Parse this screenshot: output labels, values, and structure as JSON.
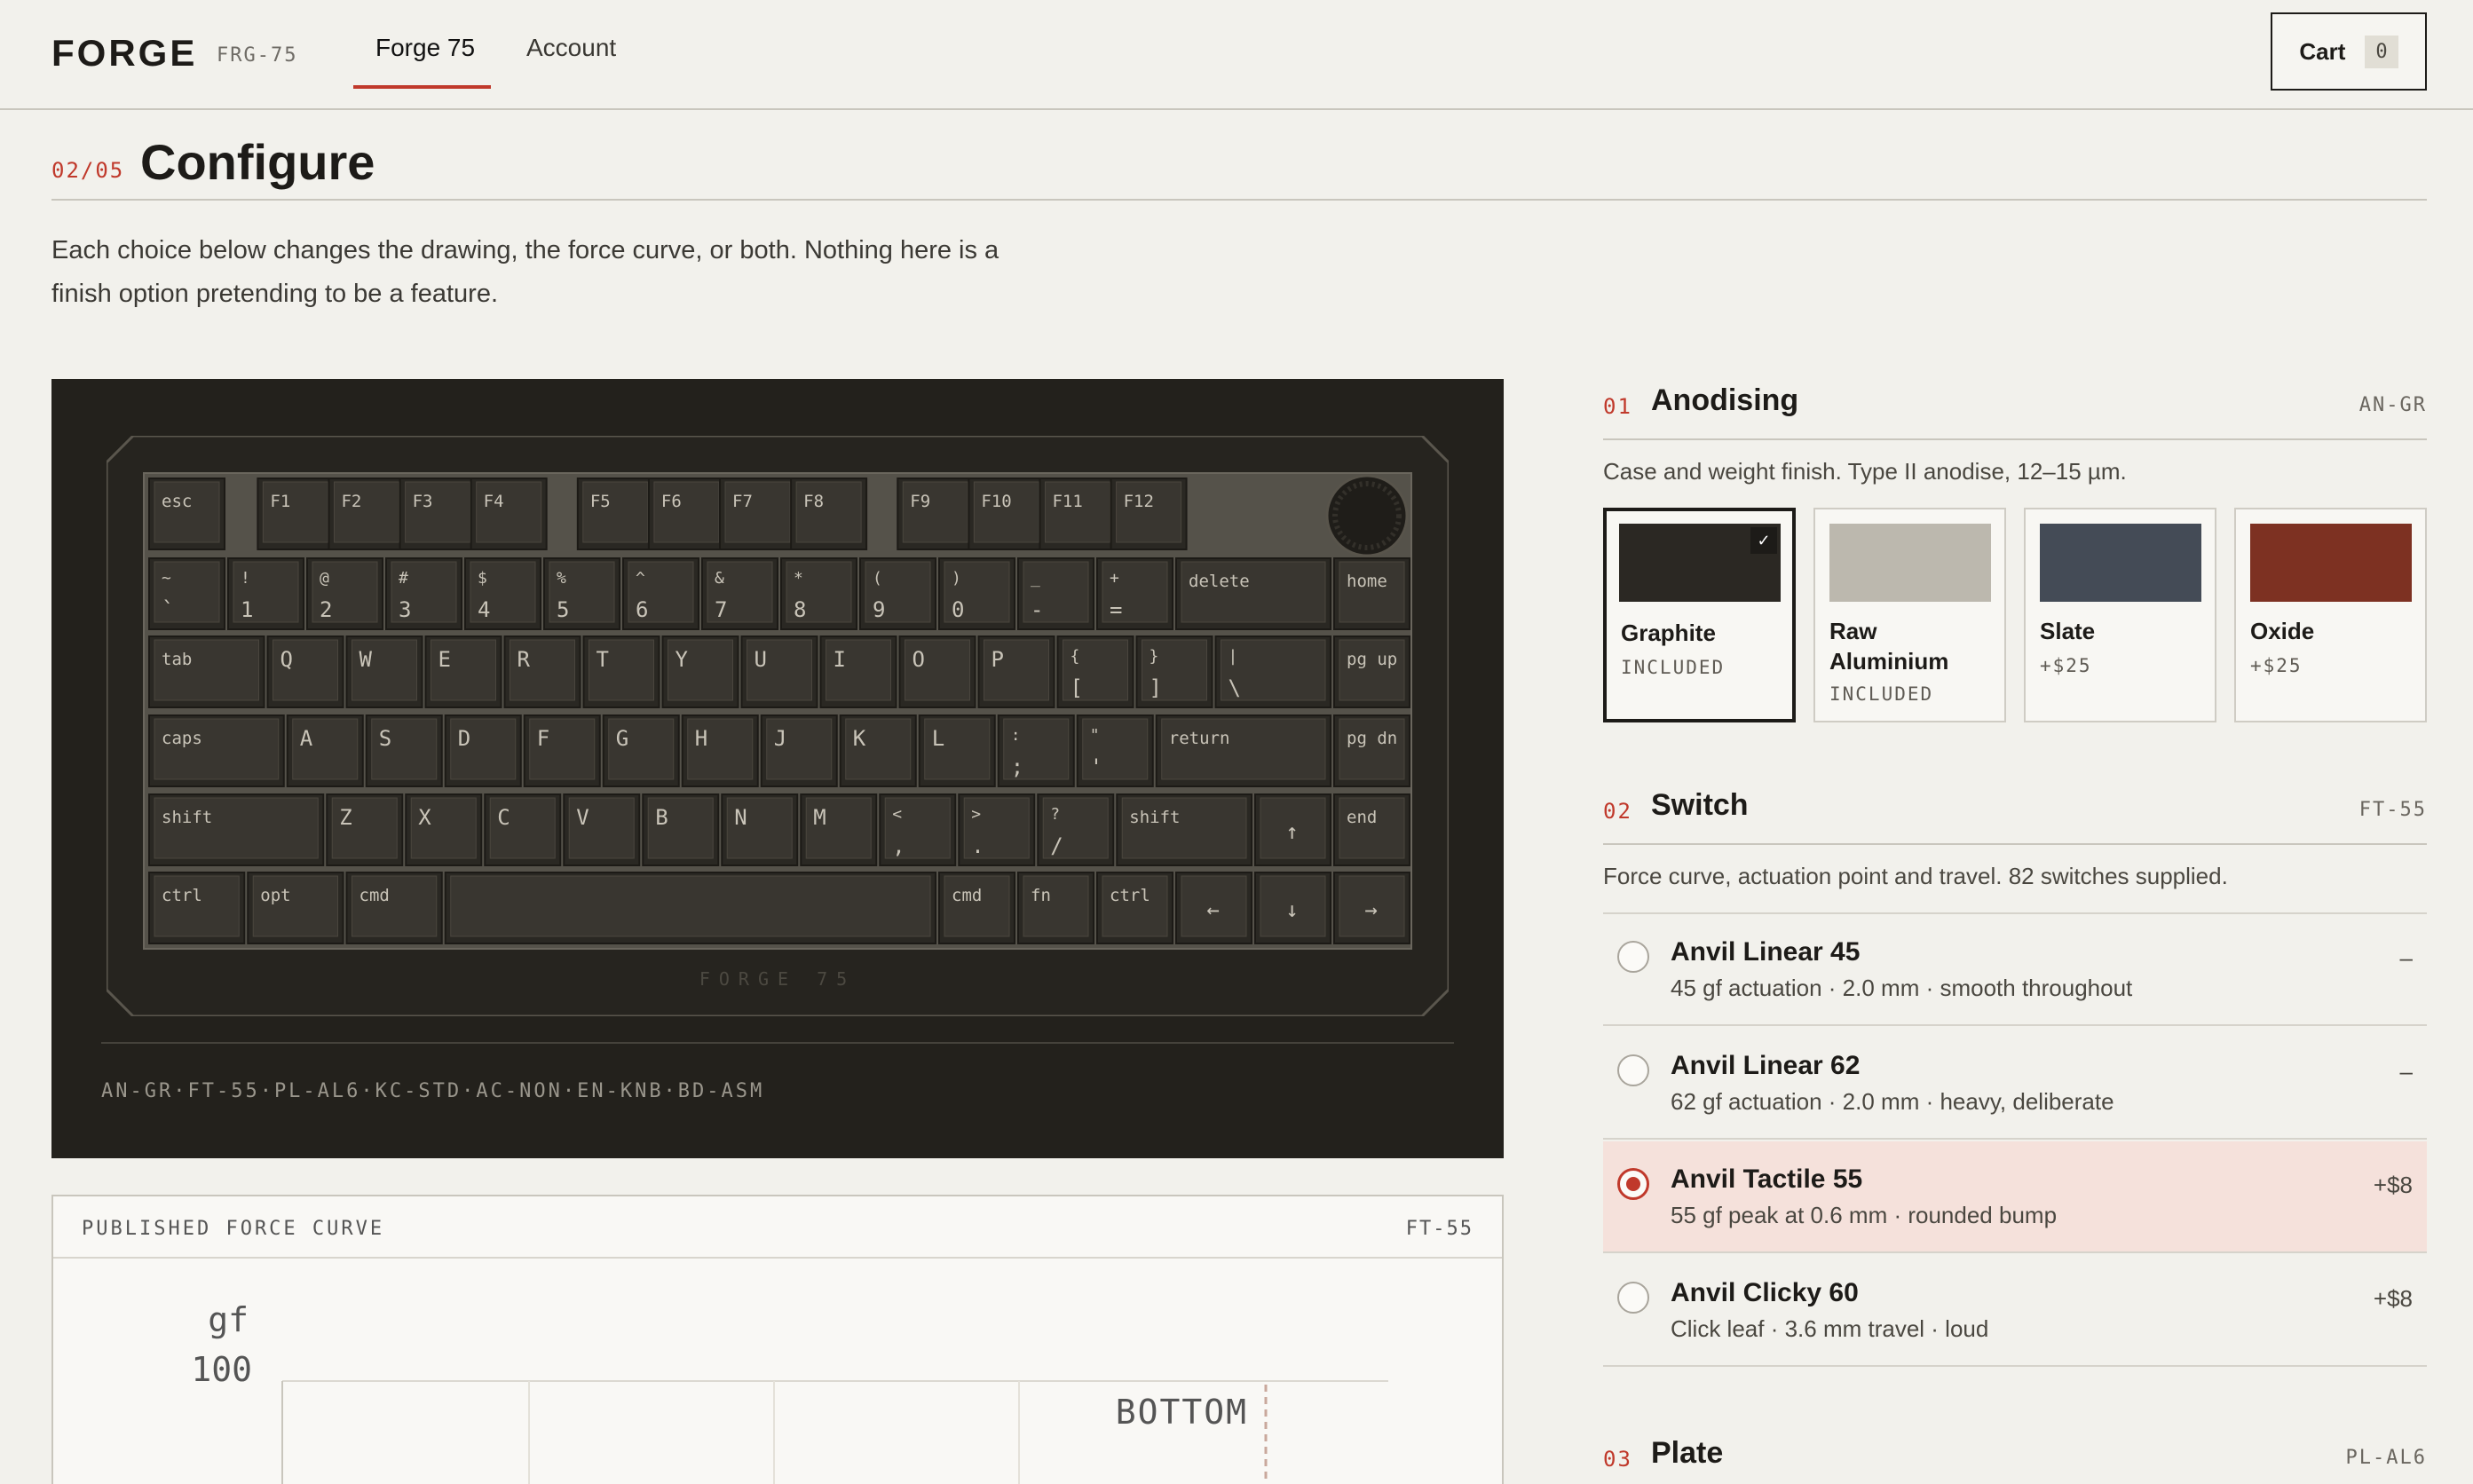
{
  "header": {
    "logo": "FORGE",
    "model_code": "FRG-75",
    "nav": [
      {
        "label": "Forge 75",
        "active": true
      },
      {
        "label": "Account",
        "active": false
      }
    ],
    "cart": {
      "label": "Cart",
      "count": "0"
    }
  },
  "page": {
    "step": "02/05",
    "title": "Configure",
    "intro": "Each choice below changes the drawing, the force curve, or both. Nothing here is a finish option pretending to be a feature."
  },
  "viewer": {
    "brand_plate": "FORGE 75",
    "config_code": "AN-GR·FT-55·PL-AL6·KC-STD·AC-NON·EN-KNB·BD-ASM",
    "keyboard_rows": [
      [
        {
          "l": "esc"
        },
        {
          "l": "F1"
        },
        {
          "l": "F2"
        },
        {
          "l": "F3"
        },
        {
          "l": "F4"
        },
        {
          "l": "F5"
        },
        {
          "l": "F6"
        },
        {
          "l": "F7"
        },
        {
          "l": "F8"
        },
        {
          "l": "F9"
        },
        {
          "l": "F10"
        },
        {
          "l": "F11"
        },
        {
          "l": "F12"
        }
      ],
      [
        {
          "t": "~",
          "b": "`"
        },
        {
          "t": "!",
          "b": "1"
        },
        {
          "t": "@",
          "b": "2"
        },
        {
          "t": "#",
          "b": "3"
        },
        {
          "t": "$",
          "b": "4"
        },
        {
          "t": "%",
          "b": "5"
        },
        {
          "t": "^",
          "b": "6"
        },
        {
          "t": "&",
          "b": "7"
        },
        {
          "t": "*",
          "b": "8"
        },
        {
          "t": "(",
          "b": "9"
        },
        {
          "t": ")",
          "b": "0"
        },
        {
          "t": "_",
          "b": "-"
        },
        {
          "t": "+",
          "b": "="
        },
        {
          "l": "delete"
        },
        {
          "l": "home"
        }
      ],
      [
        {
          "l": "tab"
        },
        {
          "c": "Q"
        },
        {
          "c": "W"
        },
        {
          "c": "E"
        },
        {
          "c": "R"
        },
        {
          "c": "T"
        },
        {
          "c": "Y"
        },
        {
          "c": "U"
        },
        {
          "c": "I"
        },
        {
          "c": "O"
        },
        {
          "c": "P"
        },
        {
          "t": "{",
          "b": "["
        },
        {
          "t": "}",
          "b": "]"
        },
        {
          "t": "|",
          "b": "\\"
        },
        {
          "l": "pg up"
        }
      ],
      [
        {
          "l": "caps"
        },
        {
          "c": "A"
        },
        {
          "c": "S"
        },
        {
          "c": "D"
        },
        {
          "c": "F"
        },
        {
          "c": "G"
        },
        {
          "c": "H"
        },
        {
          "c": "J"
        },
        {
          "c": "K"
        },
        {
          "c": "L"
        },
        {
          "t": ":",
          "b": ";"
        },
        {
          "t": "\"",
          "b": "'"
        },
        {
          "l": "return"
        },
        {
          "l": "pg dn"
        }
      ],
      [
        {
          "l": "shift"
        },
        {
          "c": "Z"
        },
        {
          "c": "X"
        },
        {
          "c": "C"
        },
        {
          "c": "V"
        },
        {
          "c": "B"
        },
        {
          "c": "N"
        },
        {
          "c": "M"
        },
        {
          "t": "<",
          "b": ","
        },
        {
          "t": ">",
          "b": "."
        },
        {
          "t": "?",
          "b": "/"
        },
        {
          "l": "shift"
        },
        {
          "c": "↑"
        },
        {
          "l": "end"
        }
      ],
      [
        {
          "l": "ctrl"
        },
        {
          "l": "opt"
        },
        {
          "l": "cmd"
        },
        {
          "l": ""
        },
        {
          "l": "cmd"
        },
        {
          "l": "fn"
        },
        {
          "l": "ctrl"
        },
        {
          "c": "←"
        },
        {
          "c": "↓"
        },
        {
          "c": "→"
        }
      ]
    ]
  },
  "force_curve": {
    "title": "PUBLISHED FORCE CURVE",
    "code": "FT-55",
    "y_unit": "gf",
    "y_max": "100",
    "bottom_label": "BOTTOM"
  },
  "sections": {
    "anodising": {
      "num": "01",
      "title": "Anodising",
      "code": "AN-GR",
      "desc": "Case and weight finish. Type II anodise, 12–15 µm.",
      "options": [
        {
          "name": "Graphite",
          "price": "INCLUDED",
          "color": "#2b2823",
          "selected": true
        },
        {
          "name": "Raw Aluminium",
          "price": "INCLUDED",
          "color": "#bcb8ae",
          "selected": false
        },
        {
          "name": "Slate",
          "price": "+$25",
          "color": "#444b56",
          "selected": false
        },
        {
          "name": "Oxide",
          "price": "+$25",
          "color": "#7d3122",
          "selected": false
        }
      ]
    },
    "switch": {
      "num": "02",
      "title": "Switch",
      "code": "FT-55",
      "desc": "Force curve, actuation point and travel. 82 switches supplied.",
      "options": [
        {
          "name": "Anvil Linear 45",
          "desc": "45 gf actuation · 2.0 mm · smooth throughout",
          "price": "–",
          "selected": false
        },
        {
          "name": "Anvil Linear 62",
          "desc": "62 gf actuation · 2.0 mm · heavy, deliberate",
          "price": "–",
          "selected": false
        },
        {
          "name": "Anvil Tactile 55",
          "desc": "55 gf peak at 0.6 mm · rounded bump",
          "price": "+$8",
          "selected": true
        },
        {
          "name": "Anvil Clicky 60",
          "desc": "Click leaf · 3.6 mm travel · loud",
          "price": "+$8",
          "selected": false
        }
      ]
    },
    "plate": {
      "num": "03",
      "title": "Plate",
      "code": "PL-AL6"
    }
  },
  "colors": {
    "accent": "#c0392b",
    "background": "#f2f1ec",
    "viewer_bg": "#23211c",
    "keycap": "#393630"
  }
}
